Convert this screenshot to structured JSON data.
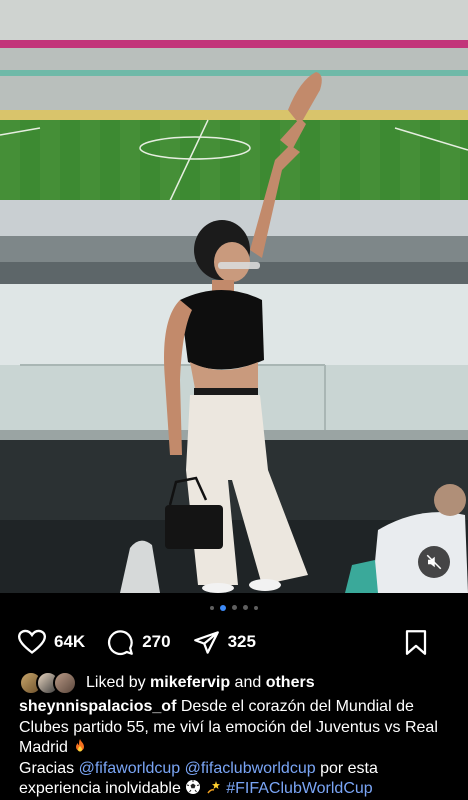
{
  "post": {
    "image_alt_icon": "stadium-photo",
    "carousel_dots": 5,
    "active_dot": 1
  },
  "actions": {
    "likes_count": "64K",
    "comments_count": "270",
    "shares_count": "325"
  },
  "liked_by": {
    "prefix": "Liked by",
    "user": "mikefervip",
    "joiner": "and",
    "others": "others"
  },
  "caption": {
    "username": "sheynnispalacios_of",
    "text_part1": "Desde el corazón del Mundial de Clubes partido 55, me viví la emoción del Juventus vs Real Madrid",
    "text_part2_prefix": "Gracias",
    "mention1": "@fifaworldcup",
    "mention2": "@fifaclubworldcup",
    "text_part2_middle": "por esta experiencia inolvidable",
    "hashtag": "#FIFAClubWorldCup"
  },
  "colors": {
    "accent_link": "#7aa5f5",
    "active_dot": "#3d8af7"
  }
}
